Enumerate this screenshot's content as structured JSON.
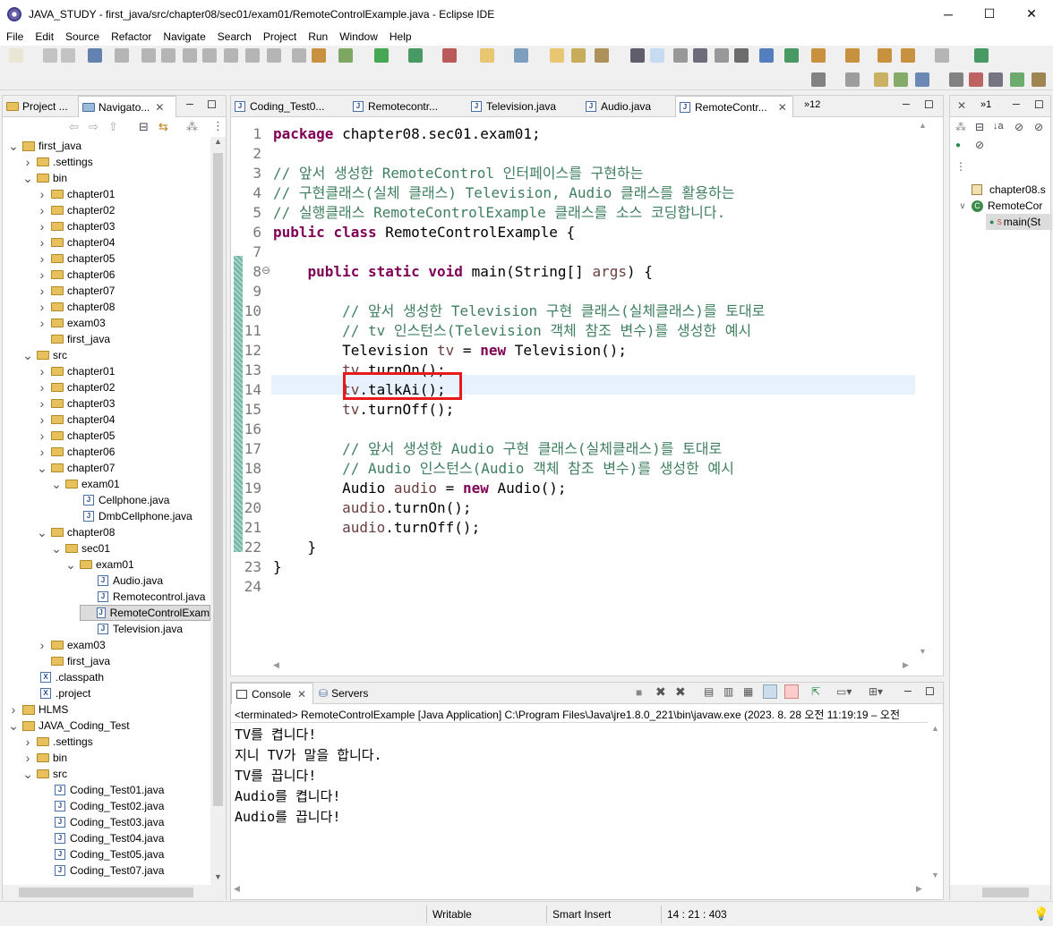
{
  "window": {
    "title": "JAVA_STUDY - first_java/src/chapter08/sec01/exam01/RemoteControlExample.java - Eclipse IDE",
    "minimize": "─",
    "maximize": "☐",
    "close": "✕"
  },
  "menu": [
    "File",
    "Edit",
    "Source",
    "Refactor",
    "Navigate",
    "Search",
    "Project",
    "Run",
    "Window",
    "Help"
  ],
  "left_panel": {
    "tabs": [
      {
        "label": "Project ..."
      },
      {
        "label": "Navigato..."
      }
    ],
    "tree": [
      {
        "label": "first_java",
        "indent": 0,
        "twisty": "v",
        "icon": "project"
      },
      {
        "label": ".settings",
        "indent": 1,
        "twisty": ">",
        "icon": "folder"
      },
      {
        "label": "bin",
        "indent": 1,
        "twisty": "v",
        "icon": "folder"
      },
      {
        "label": "chapter01",
        "indent": 2,
        "twisty": ">",
        "icon": "folder"
      },
      {
        "label": "chapter02",
        "indent": 2,
        "twisty": ">",
        "icon": "folder"
      },
      {
        "label": "chapter03",
        "indent": 2,
        "twisty": ">",
        "icon": "folder"
      },
      {
        "label": "chapter04",
        "indent": 2,
        "twisty": ">",
        "icon": "folder"
      },
      {
        "label": "chapter05",
        "indent": 2,
        "twisty": ">",
        "icon": "folder"
      },
      {
        "label": "chapter06",
        "indent": 2,
        "twisty": ">",
        "icon": "folder"
      },
      {
        "label": "chapter07",
        "indent": 2,
        "twisty": ">",
        "icon": "folder"
      },
      {
        "label": "chapter08",
        "indent": 2,
        "twisty": ">",
        "icon": "folder"
      },
      {
        "label": "exam03",
        "indent": 2,
        "twisty": ">",
        "icon": "folder"
      },
      {
        "label": "first_java",
        "indent": 2,
        "twisty": "",
        "icon": "folder"
      },
      {
        "label": "src",
        "indent": 1,
        "twisty": "v",
        "icon": "folder"
      },
      {
        "label": "chapter01",
        "indent": 2,
        "twisty": ">",
        "icon": "folder"
      },
      {
        "label": "chapter02",
        "indent": 2,
        "twisty": ">",
        "icon": "folder"
      },
      {
        "label": "chapter03",
        "indent": 2,
        "twisty": ">",
        "icon": "folder"
      },
      {
        "label": "chapter04",
        "indent": 2,
        "twisty": ">",
        "icon": "folder"
      },
      {
        "label": "chapter05",
        "indent": 2,
        "twisty": ">",
        "icon": "folder"
      },
      {
        "label": "chapter06",
        "indent": 2,
        "twisty": ">",
        "icon": "folder"
      },
      {
        "label": "chapter07",
        "indent": 2,
        "twisty": "v",
        "icon": "folder"
      },
      {
        "label": "exam01",
        "indent": 3,
        "twisty": "v",
        "icon": "folder"
      },
      {
        "label": "Cellphone.java",
        "indent": 4,
        "twisty": "",
        "icon": "java"
      },
      {
        "label": "DmbCellphone.java",
        "indent": 4,
        "twisty": "",
        "icon": "java"
      },
      {
        "label": "chapter08",
        "indent": 2,
        "twisty": "v",
        "icon": "folder"
      },
      {
        "label": "sec01",
        "indent": 3,
        "twisty": "v",
        "icon": "folder"
      },
      {
        "label": "exam01",
        "indent": 4,
        "twisty": "v",
        "icon": "folder"
      },
      {
        "label": "Audio.java",
        "indent": 5,
        "twisty": "",
        "icon": "java"
      },
      {
        "label": "Remotecontrol.java",
        "indent": 5,
        "twisty": "",
        "icon": "java"
      },
      {
        "label": "RemoteControlExam",
        "indent": 5,
        "twisty": "",
        "icon": "java",
        "selected": true
      },
      {
        "label": "Television.java",
        "indent": 5,
        "twisty": "",
        "icon": "java"
      },
      {
        "label": "exam03",
        "indent": 2,
        "twisty": ">",
        "icon": "folder"
      },
      {
        "label": "first_java",
        "indent": 2,
        "twisty": "",
        "icon": "folder"
      },
      {
        "label": ".classpath",
        "indent": 1,
        "twisty": "",
        "icon": "x"
      },
      {
        "label": ".project",
        "indent": 1,
        "twisty": "",
        "icon": "x"
      },
      {
        "label": "HLMS",
        "indent": 0,
        "twisty": ">",
        "icon": "project"
      },
      {
        "label": "JAVA_Coding_Test",
        "indent": 0,
        "twisty": "v",
        "icon": "project"
      },
      {
        "label": ".settings",
        "indent": 1,
        "twisty": ">",
        "icon": "folder"
      },
      {
        "label": "bin",
        "indent": 1,
        "twisty": ">",
        "icon": "folder"
      },
      {
        "label": "src",
        "indent": 1,
        "twisty": "v",
        "icon": "folder"
      },
      {
        "label": "Coding_Test01.java",
        "indent": 2,
        "twisty": "",
        "icon": "java"
      },
      {
        "label": "Coding_Test02.java",
        "indent": 2,
        "twisty": "",
        "icon": "java"
      },
      {
        "label": "Coding_Test03.java",
        "indent": 2,
        "twisty": "",
        "icon": "java"
      },
      {
        "label": "Coding_Test04.java",
        "indent": 2,
        "twisty": "",
        "icon": "java"
      },
      {
        "label": "Coding_Test05.java",
        "indent": 2,
        "twisty": "",
        "icon": "java"
      },
      {
        "label": "Coding_Test07.java",
        "indent": 2,
        "twisty": "",
        "icon": "java"
      }
    ]
  },
  "editor": {
    "tabs": [
      {
        "label": "Coding_Test0..."
      },
      {
        "label": "Remotecontr..."
      },
      {
        "label": "Television.java"
      },
      {
        "label": "Audio.java"
      },
      {
        "label": "RemoteContr...",
        "active": true
      }
    ],
    "overflow": "»12",
    "code": [
      [
        {
          "t": "package",
          "c": "kw"
        },
        {
          "t": " chapter08.sec01.exam01;"
        }
      ],
      [],
      [
        {
          "t": "// 앞서 생성한 RemoteControl 인터페이스를 구현하는",
          "c": "cm"
        }
      ],
      [
        {
          "t": "// 구현클래스(실체 클래스) Television, Audio 클래스를 활용하는",
          "c": "cm"
        }
      ],
      [
        {
          "t": "// 실행클래스 RemoteControlExample 클래스를 소스 코딩합니다.",
          "c": "cm"
        }
      ],
      [
        {
          "t": "public",
          "c": "kw"
        },
        {
          "t": " "
        },
        {
          "t": "class",
          "c": "kw"
        },
        {
          "t": " RemoteControlExample {"
        }
      ],
      [],
      [
        {
          "t": "    "
        },
        {
          "t": "public",
          "c": "kw"
        },
        {
          "t": " "
        },
        {
          "t": "static",
          "c": "kw"
        },
        {
          "t": " "
        },
        {
          "t": "void",
          "c": "kw"
        },
        {
          "t": " main(String[] "
        },
        {
          "t": "args",
          "c": "vr"
        },
        {
          "t": ") {"
        }
      ],
      [],
      [
        {
          "t": "        "
        },
        {
          "t": "// 앞서 생성한 Television 구현 클래스(실체클래스)를 토대로",
          "c": "cm"
        }
      ],
      [
        {
          "t": "        "
        },
        {
          "t": "// tv 인스턴스(Television 객체 참조 변수)를 생성한 예시",
          "c": "cm"
        }
      ],
      [
        {
          "t": "        Television "
        },
        {
          "t": "tv",
          "c": "vr"
        },
        {
          "t": " = "
        },
        {
          "t": "new",
          "c": "kw"
        },
        {
          "t": " Television();"
        }
      ],
      [
        {
          "t": "        "
        },
        {
          "t": "tv",
          "c": "vr"
        },
        {
          "t": ".turnOn();"
        }
      ],
      [
        {
          "t": "        "
        },
        {
          "t": "tv",
          "c": "vr"
        },
        {
          "t": ".talkAi();"
        }
      ],
      [
        {
          "t": "        "
        },
        {
          "t": "tv",
          "c": "vr"
        },
        {
          "t": ".turnOff();"
        }
      ],
      [],
      [
        {
          "t": "        "
        },
        {
          "t": "// 앞서 생성한 Audio 구현 클래스(실체클래스)를 토대로",
          "c": "cm"
        }
      ],
      [
        {
          "t": "        "
        },
        {
          "t": "// Audio 인스턴스(Audio 객체 참조 변수)를 생성한 예시",
          "c": "cm"
        }
      ],
      [
        {
          "t": "        Audio "
        },
        {
          "t": "audio",
          "c": "vr"
        },
        {
          "t": " = "
        },
        {
          "t": "new",
          "c": "kw"
        },
        {
          "t": " Audio();"
        }
      ],
      [
        {
          "t": "        "
        },
        {
          "t": "audio",
          "c": "vr"
        },
        {
          "t": ".turnOn();"
        }
      ],
      [
        {
          "t": "        "
        },
        {
          "t": "audio",
          "c": "vr"
        },
        {
          "t": ".turnOff();"
        }
      ],
      [
        {
          "t": "    }"
        }
      ],
      [
        {
          "t": "}"
        }
      ],
      []
    ],
    "line_numbers": [
      "1",
      "2",
      "3",
      "4",
      "5",
      "6",
      "7",
      "8",
      "9",
      "10",
      "11",
      "12",
      "13",
      "14",
      "15",
      "16",
      "17",
      "18",
      "19",
      "20",
      "21",
      "22",
      "23",
      "24"
    ],
    "fold_marker": "⊖"
  },
  "console": {
    "tabs": [
      {
        "label": "Console",
        "active": true
      },
      {
        "label": "Servers"
      }
    ],
    "status": "<terminated> RemoteControlExample [Java Application] C:\\Program Files\\Java\\jre1.8.0_221\\bin\\javaw.exe  (2023. 8. 28 오전 11:19:19 – 오전",
    "output": [
      "TV를 켭니다!",
      "지니 TV가 말을 합니다.",
      "TV를 끕니다!",
      "Audio를 켭니다!",
      "Audio를 끕니다!"
    ]
  },
  "outline": {
    "tabs": [
      {
        "label": "»1"
      }
    ],
    "items": [
      {
        "label": "chapter08.s"
      },
      {
        "label": "RemoteCor"
      },
      {
        "label": "main(St"
      }
    ]
  },
  "statusbar": {
    "writable": "Writable",
    "insert": "Smart Insert",
    "position": "14 : 21 : 403"
  },
  "colors": {
    "highlight_box": "#e8191b",
    "current_line": "#e8f2fe",
    "selection": "#cce8ff"
  }
}
